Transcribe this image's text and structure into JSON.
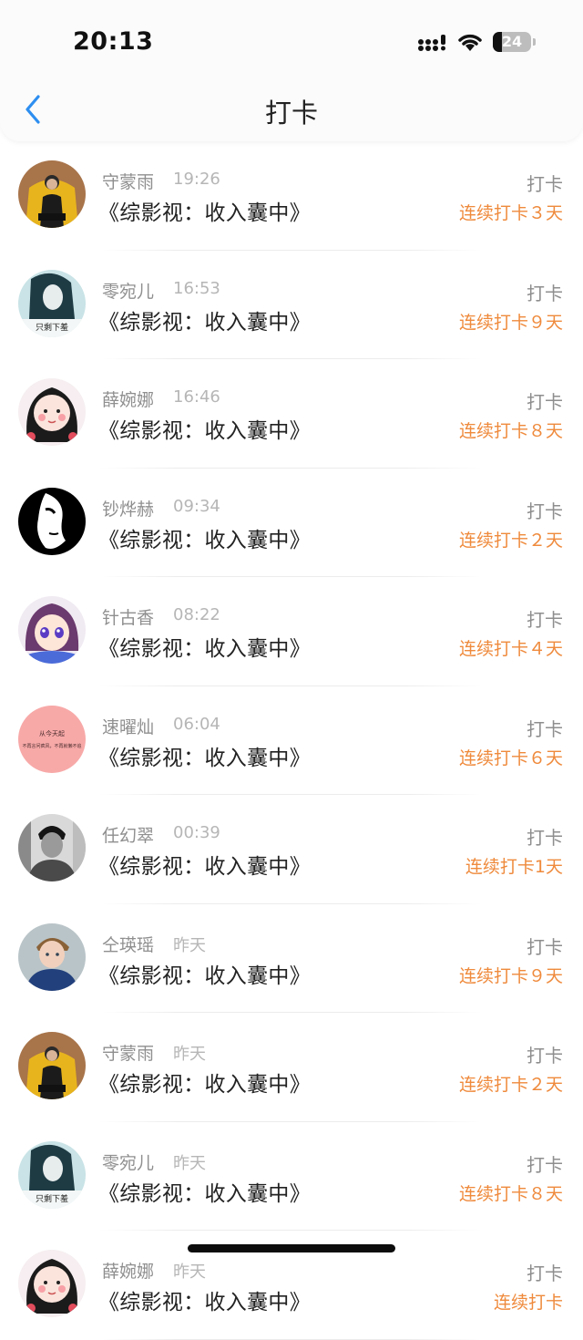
{
  "status_bar": {
    "time": "20:13",
    "battery": "24"
  },
  "header": {
    "title": "打卡"
  },
  "colors": {
    "streak": "#ef8a3c",
    "name": "#8f8f8f",
    "accent": "#2d8ef0"
  },
  "items": [
    {
      "name": "守蒙雨",
      "time": "19:26",
      "book": "《综影视：收入囊中》",
      "tag": "打卡",
      "streak": "连续打卡３天",
      "avatar": "man-yellow-chair"
    },
    {
      "name": "零宛儿",
      "time": "16:53",
      "book": "《综影视：收入囊中》",
      "tag": "打卡",
      "streak": "连续打卡９天",
      "avatar": "girl-teal",
      "avatar_text": "只剩下羞"
    },
    {
      "name": "薛婉娜",
      "time": "16:46",
      "book": "《综影视：收入囊中》",
      "tag": "打卡",
      "streak": "连续打卡８天",
      "avatar": "cartoon-girl"
    },
    {
      "name": "钞烨赫",
      "time": "09:34",
      "book": "《综影视：收入囊中》",
      "tag": "打卡",
      "streak": "连续打卡２天",
      "avatar": "white-mask"
    },
    {
      "name": "针古香",
      "time": "08:22",
      "book": "《综影视：收入囊中》",
      "tag": "打卡",
      "streak": "连续打卡４天",
      "avatar": "anime-girl"
    },
    {
      "name": "速曜灿",
      "time": "06:04",
      "book": "《综影视：收入囊中》",
      "tag": "打卡",
      "streak": "连续打卡６天",
      "avatar": "pink-text",
      "avatar_text": "从今天起",
      "avatar_text2": "不再言问疯风，不再就懒不追"
    },
    {
      "name": "任幻翠",
      "time": "00:39",
      "book": "《综影视：收入囊中》",
      "tag": "打卡",
      "streak": "连续打卡1天",
      "avatar": "man-bw"
    },
    {
      "name": "仝瑛瑶",
      "time": "昨天",
      "book": "《综影视：收入囊中》",
      "tag": "打卡",
      "streak": "连续打卡９天",
      "avatar": "boy-blue"
    },
    {
      "name": "守蒙雨",
      "time": "昨天",
      "book": "《综影视：收入囊中》",
      "tag": "打卡",
      "streak": "连续打卡２天",
      "avatar": "man-yellow-chair"
    },
    {
      "name": "零宛儿",
      "time": "昨天",
      "book": "《综影视：收入囊中》",
      "tag": "打卡",
      "streak": "连续打卡８天",
      "avatar": "girl-teal",
      "avatar_text": "只剩下羞"
    },
    {
      "name": "薛婉娜",
      "time": "昨天",
      "book": "《综影视：收入囊中》",
      "tag": "打卡",
      "streak": "连续打卡",
      "avatar": "cartoon-girl"
    }
  ]
}
